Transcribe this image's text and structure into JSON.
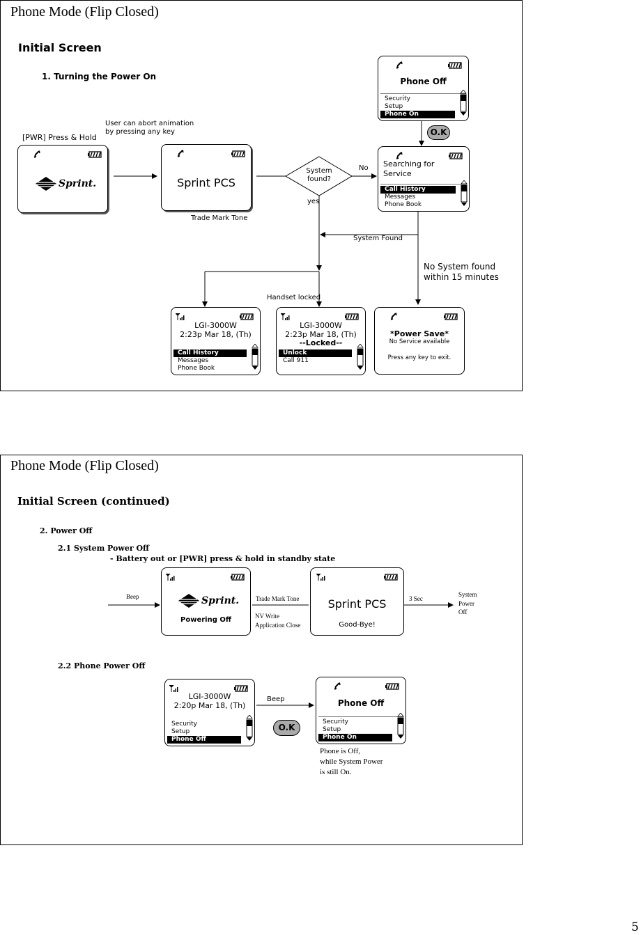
{
  "panel1": {
    "title": "Phone Mode (Flip Closed)",
    "heading": "Initial Screen",
    "section": "1. Turning the Power On",
    "pwr_label": "[PWR] Press & Hold",
    "abort_note": [
      "User can abort animation",
      "by pressing any key"
    ],
    "logo_text": "Sprint.",
    "sprint_pcs": "Sprint PCS",
    "trade_mark_tone": "Trade Mark Tone",
    "decision": [
      "System",
      "found?"
    ],
    "no_label": "No",
    "yes_label": "yes",
    "system_found": "System Found",
    "no_system": [
      "No System found",
      "within 15 minutes"
    ],
    "handset_locked": "Handset locked",
    "ok_label": "O.K",
    "phone_off_screen": {
      "title": "Phone Off",
      "menu": [
        "Security",
        "Setup",
        "Phone On"
      ]
    },
    "searching_screen": {
      "title": [
        "Searching for",
        "Service"
      ],
      "menu": [
        "Call History",
        "Messages",
        "Phone Book"
      ]
    },
    "idle_screen": {
      "model": "LGI-3000W",
      "time": "2:23p Mar 18, (Th)",
      "menu": [
        "Call History",
        "Messages",
        "Phone Book"
      ]
    },
    "locked_screen": {
      "model": "LGI-3000W",
      "time": "2:23p Mar 18, (Th)",
      "locked": "--Locked--",
      "menu": [
        "Unlock",
        "Call 911"
      ]
    },
    "power_save_screen": {
      "title": "*Power Save*",
      "sub": "No Service available",
      "hint": "Press any key to exit."
    }
  },
  "panel2": {
    "title": "Phone Mode (Flip Closed)",
    "heading": "Initial Screen (continued)",
    "section": "2. Power Off",
    "sub1": "2.1 System Power Off",
    "sub1_note": "- Battery out or [PWR] press & hold in standby state",
    "beep": "Beep",
    "logo_text": "Sprint.",
    "powering_off": "Powering Off",
    "trade_mark_tone": "Trade Mark Tone",
    "nv_write": [
      "NV Write",
      "Application Close"
    ],
    "sprint_pcs": "Sprint PCS",
    "good_bye": "Good-Bye!",
    "three_sec": "3 Sec",
    "system_power_off": [
      "System",
      "Power",
      "Off"
    ],
    "sub2": "2.2 Phone Power Off",
    "idle_screen": {
      "model": "LGI-3000W",
      "time": "2:20p Mar 18, (Th)",
      "menu": [
        "Security",
        "Setup",
        "Phone Off"
      ]
    },
    "beep2": "Beep",
    "ok_label": "O.K",
    "phone_off_screen": {
      "title": "Phone Off",
      "menu": [
        "Security",
        "Setup",
        "Phone On"
      ]
    },
    "note": [
      "Phone is Off,",
      "while System Power",
      "is still On."
    ]
  },
  "page_number": "5"
}
